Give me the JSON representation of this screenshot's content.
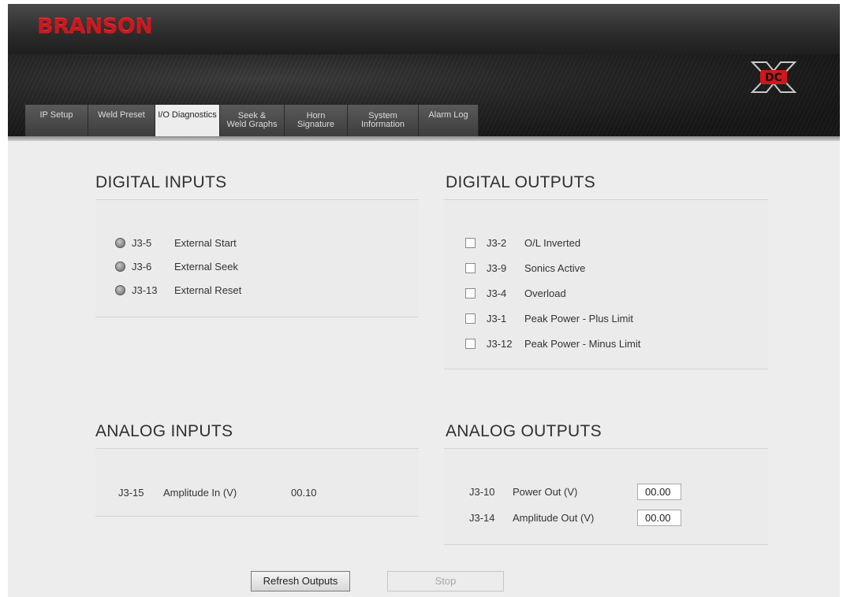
{
  "brand": {
    "logo_text": "BRANSON",
    "product_logo_text": "DC"
  },
  "tabs": [
    {
      "label": "IP Setup"
    },
    {
      "label": "Weld Preset"
    },
    {
      "label": "I/O Diagnostics"
    },
    {
      "line1": "Seek &",
      "line2": "Weld Graphs"
    },
    {
      "line1": "Horn",
      "line2": "Signature"
    },
    {
      "line1": "System",
      "line2": "Information"
    },
    {
      "label": "Alarm Log"
    }
  ],
  "digital_inputs": {
    "title": "DIGITAL INPUTS",
    "items": [
      {
        "pin": "J3-5",
        "label": "External Start"
      },
      {
        "pin": "J3-6",
        "label": "External Seek"
      },
      {
        "pin": "J3-13",
        "label": "External Reset"
      }
    ]
  },
  "digital_outputs": {
    "title": "DIGITAL OUTPUTS",
    "items": [
      {
        "pin": "J3-2",
        "label": "O/L Inverted"
      },
      {
        "pin": "J3-9",
        "label": "Sonics Active"
      },
      {
        "pin": "J3-4",
        "label": "Overload"
      },
      {
        "pin": "J3-1",
        "label": "Peak Power - Plus Limit"
      },
      {
        "pin": "J3-12",
        "label": "Peak Power - Minus Limit"
      }
    ]
  },
  "analog_inputs": {
    "title": "ANALOG INPUTS",
    "items": [
      {
        "pin": "J3-15",
        "label": "Amplitude In (V)",
        "value": "00.10"
      }
    ]
  },
  "analog_outputs": {
    "title": "ANALOG OUTPUTS",
    "items": [
      {
        "pin": "J3-10",
        "label": "Power Out (V)",
        "value": "00.00"
      },
      {
        "pin": "J3-14",
        "label": "Amplitude Out (V)",
        "value": "00.00"
      }
    ]
  },
  "buttons": {
    "refresh_label": "Refresh Outputs",
    "stop_label": "Stop"
  },
  "colors": {
    "brand_red": "#c8191f",
    "header_dark": "#2b2b2b",
    "content_bg": "#ededed"
  }
}
